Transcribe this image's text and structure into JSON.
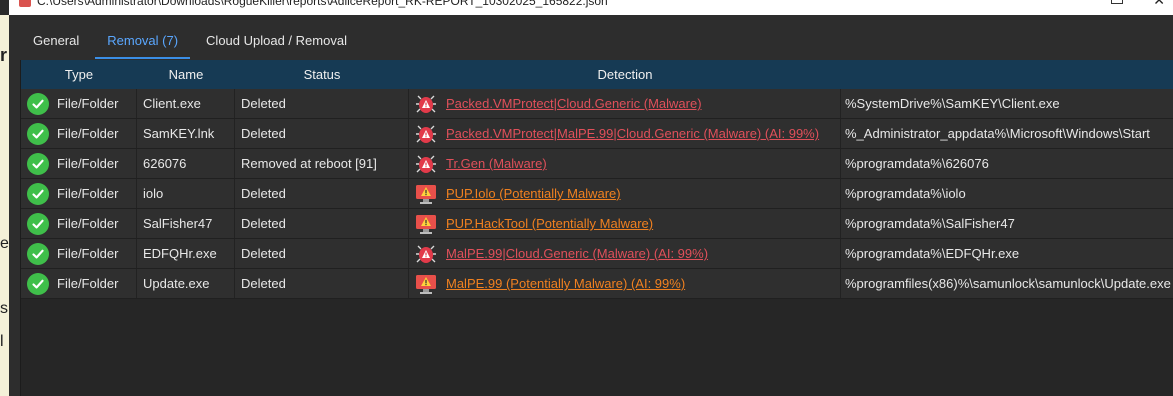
{
  "window": {
    "title": "C:\\Users\\Administrator\\Downloads\\RogueKiller\\reports\\AdliceReport_RK-REPORT_10302025_165822.json"
  },
  "tabs": [
    {
      "label": "General"
    },
    {
      "label": "Removal (7)",
      "active": true
    },
    {
      "label": "Cloud Upload / Removal"
    }
  ],
  "table": {
    "columns": [
      "Type",
      "Name",
      "Status",
      "Detection"
    ],
    "rows": [
      {
        "type": "File/Folder",
        "name": "Client.exe",
        "status": "Deleted",
        "detection": "Packed.VMProtect|Cloud.Generic (Malware)",
        "severity": "malware",
        "path": "%SystemDrive%\\SamKEY\\Client.exe"
      },
      {
        "type": "File/Folder",
        "name": "SamKEY.lnk",
        "status": "Deleted",
        "detection": "Packed.VMProtect|MalPE.99|Cloud.Generic (Malware) (AI: 99%)",
        "severity": "malware",
        "path": "%_Administrator_appdata%\\Microsoft\\Windows\\Start"
      },
      {
        "type": "File/Folder",
        "name": "626076",
        "status": "Removed at reboot [91]",
        "detection": "Tr.Gen (Malware)",
        "severity": "malware",
        "path": "%programdata%\\626076"
      },
      {
        "type": "File/Folder",
        "name": "iolo",
        "status": "Deleted",
        "detection": "PUP.Iolo (Potentially Malware)",
        "severity": "pup",
        "path": "%programdata%\\iolo"
      },
      {
        "type": "File/Folder",
        "name": "SalFisher47",
        "status": "Deleted",
        "detection": "PUP.HackTool (Potentially Malware)",
        "severity": "pup",
        "path": "%programdata%\\SalFisher47"
      },
      {
        "type": "File/Folder",
        "name": "EDFQHr.exe",
        "status": "Deleted",
        "detection": "MalPE.99|Cloud.Generic (Malware) (AI: 99%)",
        "severity": "malware",
        "path": "%programdata%\\EDFQHr.exe"
      },
      {
        "type": "File/Folder",
        "name": "Update.exe",
        "status": "Deleted",
        "detection": "MalPE.99 (Potentially Malware) (AI: 99%)",
        "severity": "pup",
        "path": "%programfiles(x86)%\\samunlock\\samunlock\\Update.exe"
      }
    ]
  },
  "icons": {
    "status": "check-circle-icon",
    "malware": "bug-icon",
    "pup": "warning-monitor-icon"
  },
  "colors": {
    "header_bg": "#163a54",
    "tab_active": "#5aa7ff",
    "malware_link": "#e0505a",
    "pup_link": "#f08020",
    "check": "#3fbf4a"
  },
  "background": {
    "fragments": [
      "r",
      "e",
      "s",
      "l"
    ]
  }
}
